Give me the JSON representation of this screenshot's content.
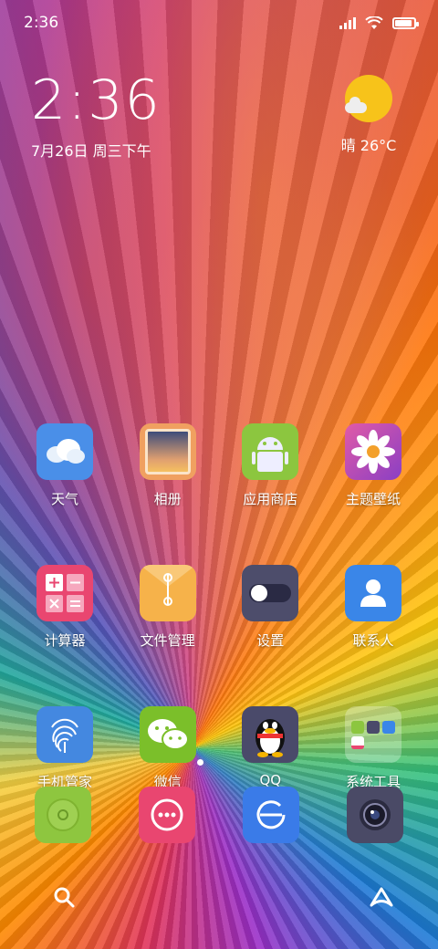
{
  "status_bar": {
    "time": "2:36",
    "battery_level": 0.9
  },
  "clock": {
    "time": "2:36",
    "date": "7月26日 周三下午"
  },
  "weather": {
    "text": "晴 26°C",
    "icon": "sun-cloud-icon"
  },
  "apps": [
    {
      "label": "天气",
      "icon": "weather-icon",
      "color": "#4a8fe8"
    },
    {
      "label": "相册",
      "icon": "gallery-icon",
      "color": "#f0a060"
    },
    {
      "label": "应用商店",
      "icon": "android-icon",
      "color": "#8cc63f"
    },
    {
      "label": "主题壁纸",
      "icon": "flower-icon",
      "color": "#c64dbb"
    },
    {
      "label": "计算器",
      "icon": "calculator-icon",
      "color": "#e94670"
    },
    {
      "label": "文件管理",
      "icon": "folder-icon",
      "color": "#f6b24a"
    },
    {
      "label": "设置",
      "icon": "toggle-icon",
      "color": "#4d4d6b"
    },
    {
      "label": "联系人",
      "icon": "contact-icon",
      "color": "#3a86e8"
    },
    {
      "label": "手机管家",
      "icon": "fingerprint-icon",
      "color": "#4488e0"
    },
    {
      "label": "微信",
      "icon": "wechat-icon",
      "color": "#7bbf2a"
    },
    {
      "label": "QQ",
      "icon": "penguin-icon",
      "color": "#4a4a6a"
    },
    {
      "label": "系统工具",
      "icon": "folder-group-icon",
      "color": "rgba(255,255,255,0.3)"
    }
  ],
  "dock": [
    {
      "name": "phone",
      "icon": "phone-icon",
      "color": "#8ec63f"
    },
    {
      "name": "messages",
      "icon": "message-icon",
      "color": "#e94670"
    },
    {
      "name": "browser",
      "icon": "browser-icon",
      "color": "#3a7be8"
    },
    {
      "name": "camera",
      "icon": "camera-icon",
      "color": "#4a4a66"
    }
  ],
  "bottom": {
    "search_icon": "search-icon",
    "assistant_icon": "assistant-icon"
  }
}
